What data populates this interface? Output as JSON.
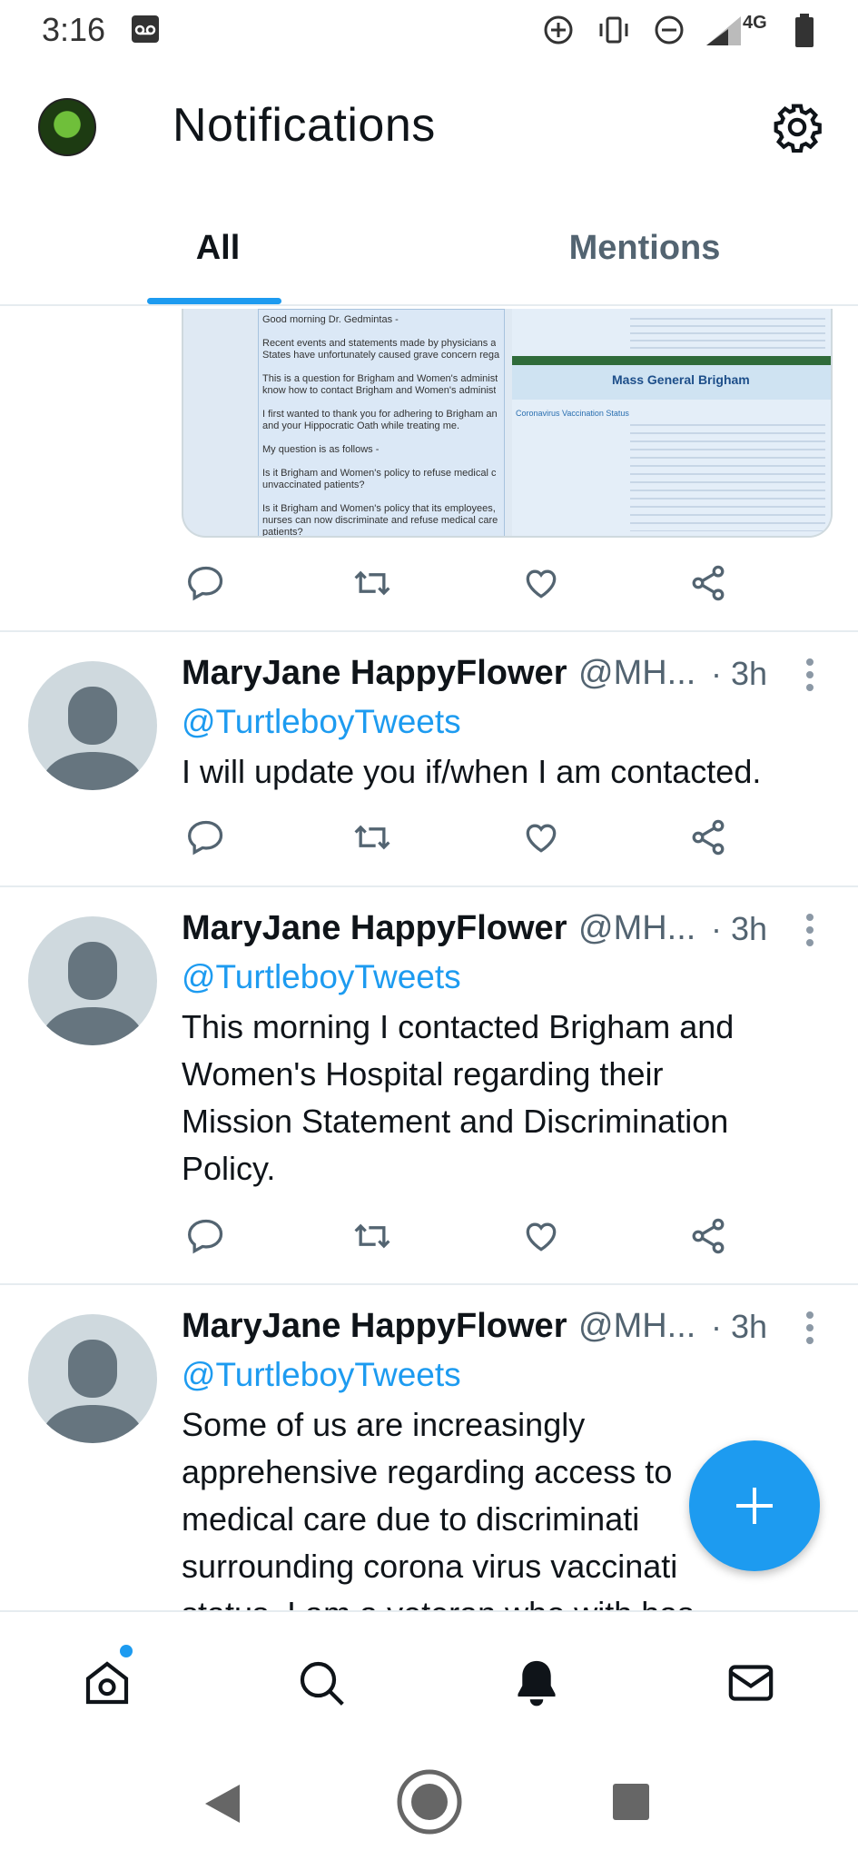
{
  "status_bar": {
    "time": "3:16",
    "icons": [
      "voicemail-icon",
      "data-saver-icon",
      "vibrate-icon",
      "do-not-disturb-icon",
      "signal-icon",
      "battery-icon"
    ],
    "network": "4G"
  },
  "header": {
    "title": "Notifications",
    "avatar_icon": "profile-avatar",
    "settings_icon": "gear-icon"
  },
  "tabs": [
    {
      "label": "All",
      "selected": true
    },
    {
      "label": "Mentions",
      "selected": false
    }
  ],
  "media_preview": {
    "left_lines": [
      "Good morning Dr. Gedmintas -",
      "Recent events and statements made by physicians a",
      "States have unfortunately caused grave concern rega",
      "This is a question for Brigham and Women's administ",
      "know how to contact Brigham and Women's administ",
      "I first wanted to thank you for adhering to Brigham an",
      "and your Hippocratic Oath while treating me.",
      "My question is as follows -",
      "Is it Brigham and Women's policy to refuse medical c",
      "unvaccinated patients?",
      "Is it Brigham and Women's policy that its employees,",
      "nurses can now discriminate and refuse medical care",
      "patients?"
    ],
    "right_title": "Mass General Brigham",
    "right_subtitle": "Coronavirus Vaccination Status"
  },
  "tweets": [
    {
      "author": "MaryJane HappyFlower",
      "handle": "@MH...",
      "time": "· 3h",
      "mention": "@TurtleboyTweets",
      "text_lines": [
        "I will update you if/when I am contacted."
      ]
    },
    {
      "author": "MaryJane HappyFlower",
      "handle": "@MH...",
      "time": "· 3h",
      "mention": "@TurtleboyTweets",
      "text_lines": [
        "This morning I contacted Brigham and",
        "Women's Hospital regarding their",
        "Mission Statement and Discrimination",
        "Policy."
      ]
    },
    {
      "author": "MaryJane HappyFlower",
      "handle": "@MH...",
      "time": "· 3h",
      "mention": "@TurtleboyTweets",
      "text_lines": [
        "Some of us are increasingly",
        "apprehensive regarding access to",
        "medical care due to discriminati",
        "surrounding corona virus vaccinati",
        "status. I am a veteran who with has"
      ]
    }
  ],
  "fab": {
    "icon": "plus-icon"
  },
  "bottom_nav": {
    "items": [
      "home-icon",
      "search-icon",
      "notifications-bell-icon",
      "messages-icon"
    ],
    "home_badge_color": "#1d9bf0"
  },
  "system_nav": {
    "items": [
      "back-icon",
      "home-circle-icon",
      "recents-icon"
    ]
  },
  "colors": {
    "accent": "#1d9bf0",
    "text": "#0f1419",
    "secondary": "#536471"
  }
}
